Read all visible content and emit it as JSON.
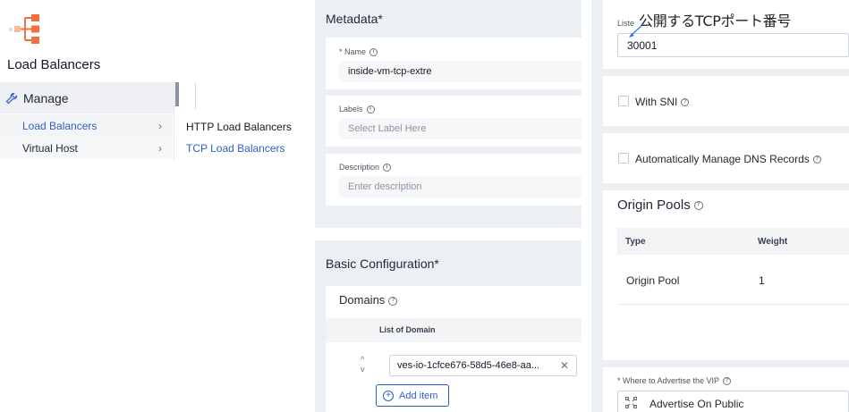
{
  "sidebar": {
    "title": "Load Balancers",
    "manage_label": "Manage",
    "items": [
      {
        "label": "Load Balancers"
      },
      {
        "label": "Virtual Host"
      }
    ],
    "flyout": [
      {
        "label": "HTTP Load Balancers"
      },
      {
        "label": "TCP Load Balancers"
      }
    ]
  },
  "metadata": {
    "title": "Metadata",
    "required_mark": "*",
    "name_label": "* Name",
    "name_value": "inside-vm-tcp-extre",
    "labels_label": "Labels",
    "labels_placeholder": "Select Label Here",
    "description_label": "Description",
    "description_placeholder": "Enter description"
  },
  "basic": {
    "title": "Basic Configuration",
    "required_mark": "*",
    "domains_title": "Domains",
    "list_header": "List of Domain",
    "domain_value": "ves-io-1cfce676-58d5-46e8-aa...",
    "add_item_label": "Add item"
  },
  "right": {
    "listen_label": "Liste",
    "listen_port_value": "30001",
    "annotation": "公開するTCPポート番号",
    "with_sni_label": "With SNI",
    "dns_label": "Automatically Manage DNS Records",
    "origin_pools_title": "Origin Pools",
    "table_headers": {
      "type": "Type",
      "weight": "Weight"
    },
    "table_rows": [
      {
        "type": "Origin Pool",
        "weight": "1"
      }
    ],
    "advertise_label": "* Where to Advertise the VIP",
    "advertise_value": "Advertise On Public"
  },
  "colors": {
    "accent": "#2d5fc7",
    "logo": "#f36f41",
    "panel_bg": "#eceff4"
  }
}
